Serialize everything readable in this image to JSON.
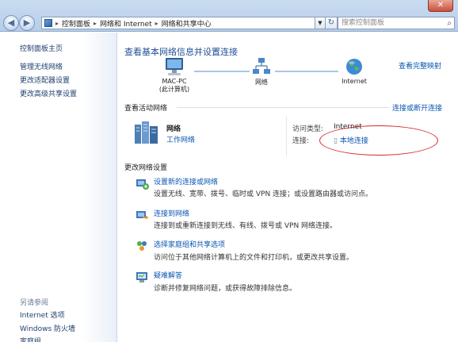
{
  "window": {
    "close_label": "✕"
  },
  "address_bar": {
    "crumbs": [
      "控制面板",
      "网络和 Internet",
      "网络和共享中心"
    ],
    "search_placeholder": "搜索控制面板"
  },
  "sidebar": {
    "top_links": [
      "控制面板主页",
      "管理无线网络",
      "更改适配器设置",
      "更改高级共享设置"
    ],
    "see_also_heading": "另请参阅",
    "see_also_links": [
      "Internet 选项",
      "Windows 防火墙",
      "家庭组"
    ]
  },
  "main": {
    "title": "查看基本网络信息并设置连接",
    "full_map_link": "查看完整映射",
    "map": {
      "computer_name": "MAC-PC",
      "computer_sub": "(此计算机)",
      "network_label": "网络",
      "internet_label": "Internet"
    },
    "active_section": {
      "header": "查看活动网络",
      "connect_link": "连接或断开连接",
      "network_name": "网络",
      "network_type": "工作网络",
      "access_type_label": "访问类型:",
      "access_type_value": "Internet",
      "connections_label": "连接:",
      "connections_value": "本地连接"
    },
    "settings_section": {
      "header": "更改网络设置",
      "tasks": [
        {
          "title": "设置新的连接或网络",
          "desc": "设置无线、宽带、拨号、临时或 VPN 连接；或设置路由器或访问点。",
          "icon": "new-connection-icon"
        },
        {
          "title": "连接到网络",
          "desc": "连接到或重新连接到无线、有线、拨号或 VPN 网络连接。",
          "icon": "connect-network-icon"
        },
        {
          "title": "选择家庭组和共享选项",
          "desc": "访问位于其他网络计算机上的文件和打印机，或更改共享设置。",
          "icon": "homegroup-icon"
        },
        {
          "title": "疑难解答",
          "desc": "诊断并修复网络问题，或获得故障排除信息。",
          "icon": "troubleshoot-icon"
        }
      ]
    }
  },
  "colors": {
    "link": "#0a56b2",
    "title": "#1f4f95",
    "highlight_ellipse": "#d42a2a"
  }
}
